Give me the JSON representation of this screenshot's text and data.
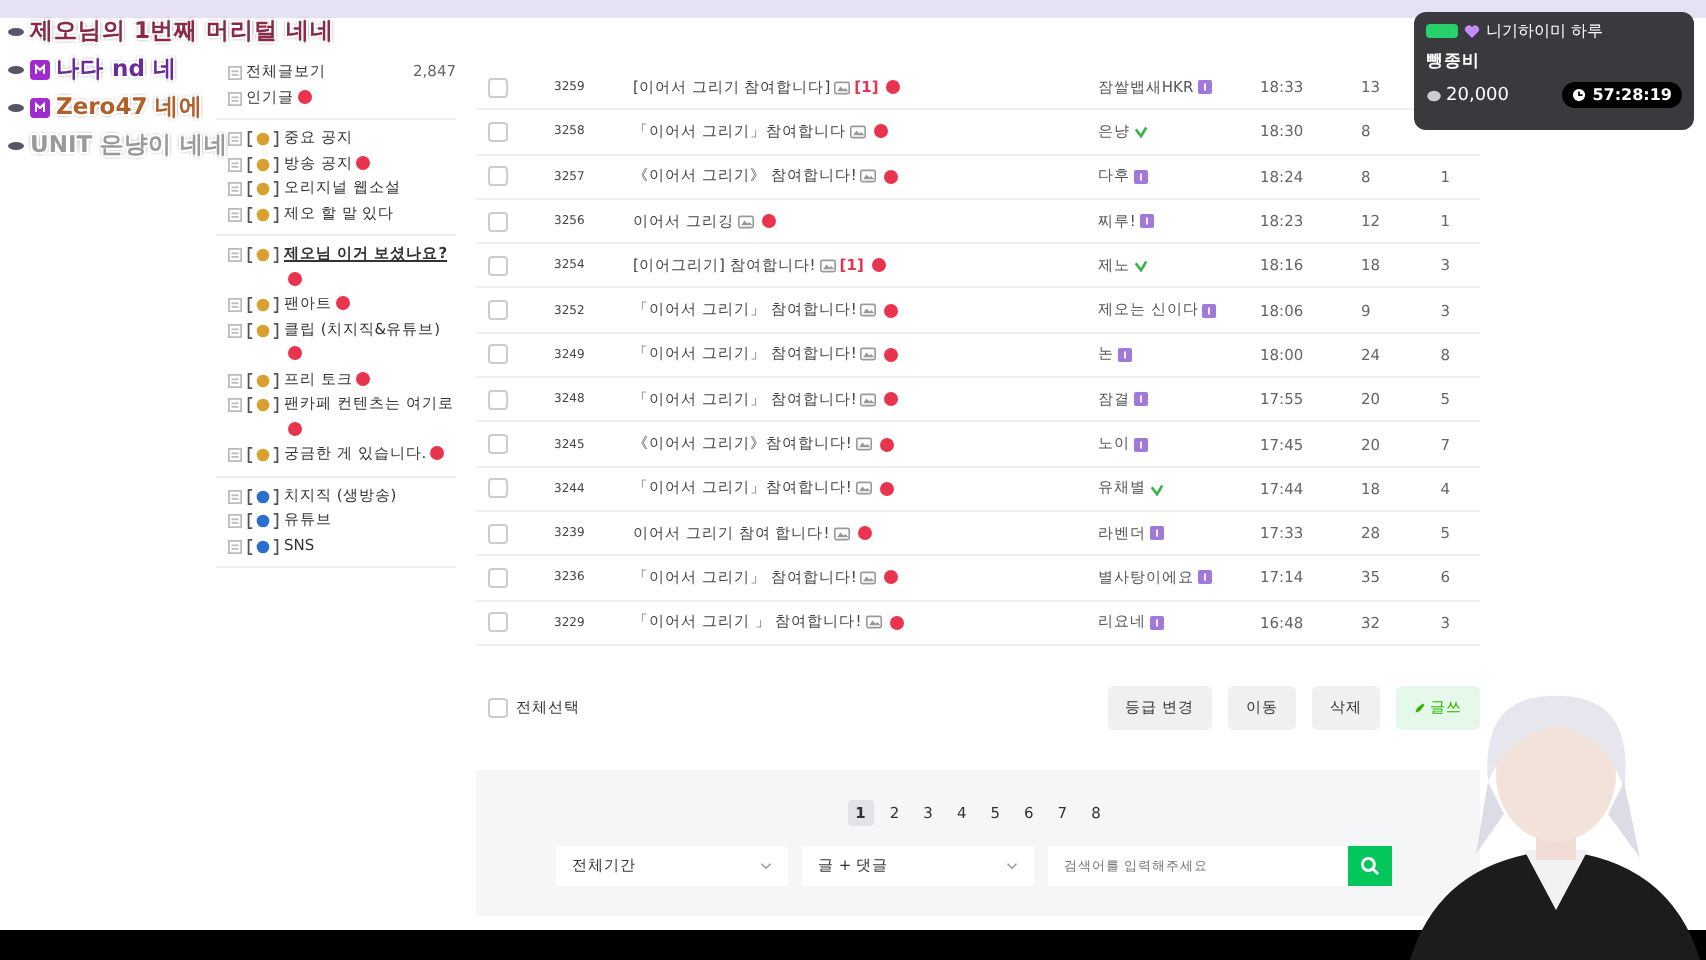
{
  "chat": [
    {
      "text": "제오님의 1번째 머리털 네네",
      "color": "#8a2a4a",
      "badge": false
    },
    {
      "text": "나다 nd 네",
      "color": "#6a2a9a",
      "badge": true
    },
    {
      "text": "Zero47 네에",
      "color": "#b0602a",
      "badge": true
    },
    {
      "text": "UNIT 은냥이 네네",
      "color": "#9a9a9a",
      "badge": false
    }
  ],
  "sidebar": {
    "groups": [
      [
        {
          "label": "전체글보기",
          "count": "2,847",
          "new": false,
          "bold": false
        },
        {
          "label": "인기글",
          "new": true,
          "bold": false
        }
      ],
      [
        {
          "label": "중요 공지",
          "new": false,
          "bold": false
        },
        {
          "label": "방송 공지",
          "new": true,
          "bold": false
        },
        {
          "label": "오리지널 웹소설",
          "new": false,
          "bold": false
        },
        {
          "label": "제오 할 말 있다",
          "new": false,
          "bold": false
        }
      ],
      [
        {
          "label": "제오님 이거 보셨나요?",
          "new": true,
          "bold": true
        },
        {
          "label": "팬아트",
          "new": true,
          "bold": false
        },
        {
          "label": "클립 (치지직&유튜브)",
          "new": true,
          "bold": false
        },
        {
          "label": "프리 토크",
          "new": true,
          "bold": false
        },
        {
          "label": "팬카페 컨텐츠는 여기로",
          "new": true,
          "bold": false
        },
        {
          "label": "궁금한 게 있습니다.",
          "new": true,
          "bold": false
        }
      ],
      [
        {
          "label": "치지직 (생방송)",
          "new": false,
          "bold": false
        },
        {
          "label": "유튜브",
          "new": false,
          "bold": false
        },
        {
          "label": "SNS",
          "new": false,
          "bold": false
        }
      ]
    ]
  },
  "rows": [
    {
      "checked": false,
      "no": "3259",
      "title": "[이어서 그리기 참여합니다]",
      "comments": "[1]",
      "author": "잠쌀뱁새HKR",
      "kind": "level",
      "time": "18:33",
      "views": "13"
    },
    {
      "checked": false,
      "no": "3258",
      "title": "「이어서 그리기」참여합니다",
      "author": "은냥",
      "kind": "check",
      "time": "18:30",
      "views": "8"
    },
    {
      "checked": false,
      "no": "3257",
      "title": "《이어서 그리기》 참여합니다!",
      "author": "다후",
      "kind": "level",
      "time": "18:24",
      "views": "8",
      "likes": "1"
    },
    {
      "checked": false,
      "no": "3256",
      "title": "이어서 그리깅",
      "author": "찌루!",
      "kind": "level",
      "time": "18:23",
      "views": "12",
      "likes": "1"
    },
    {
      "checked": false,
      "no": "3254",
      "title": "[이어그리기] 참여합니다!",
      "comments": "[1]",
      "author": "제노",
      "kind": "check",
      "time": "18:16",
      "views": "18",
      "likes": "3"
    },
    {
      "checked": false,
      "no": "3252",
      "title": "「이어서 그리기」 참여합니다!",
      "author": "제오는 신이다",
      "kind": "level",
      "time": "18:06",
      "views": "9",
      "likes": "3"
    },
    {
      "checked": false,
      "no": "3249",
      "title": "「이어서 그리기」 참여합니다!",
      "author": "논",
      "kind": "level",
      "time": "18:00",
      "views": "24",
      "likes": "8"
    },
    {
      "checked": false,
      "no": "3248",
      "title": "「이어서 그리기」 참여합니다!",
      "author": "잠결",
      "kind": "level",
      "time": "17:55",
      "views": "20",
      "likes": "5"
    },
    {
      "checked": false,
      "no": "3245",
      "title": "《이어서 그리기》참여합니다!",
      "author": "노이",
      "kind": "level",
      "time": "17:45",
      "views": "20",
      "likes": "7"
    },
    {
      "checked": false,
      "no": "3244",
      "title": "「이어서 그리기」참여합니다!",
      "author": "유채별",
      "kind": "check",
      "time": "17:44",
      "views": "18",
      "likes": "4"
    },
    {
      "checked": false,
      "no": "3239",
      "title": "이어서 그리기 참여 합니다!",
      "author": "라벤더",
      "kind": "level",
      "time": "17:33",
      "views": "28",
      "likes": "5"
    },
    {
      "checked": false,
      "no": "3236",
      "title": "「이어서 그리기」 참여합니다!",
      "author": "별사탕이에요",
      "kind": "level",
      "time": "17:14",
      "views": "35",
      "likes": "6"
    },
    {
      "checked": false,
      "no": "3229",
      "title": "「이어서 그리기 」 참여합니다!",
      "author": "리요네",
      "kind": "level",
      "time": "16:48",
      "views": "32",
      "likes": "3"
    }
  ],
  "select_all": {
    "label": "전체선택",
    "checked": false
  },
  "actions": [
    "등급 변경",
    "이동",
    "삭제"
  ],
  "write_button": "글쓰",
  "pages": [
    {
      "label": "1",
      "selected": true
    },
    {
      "label": "2",
      "selected": false
    },
    {
      "label": "3",
      "selected": false
    },
    {
      "label": "4",
      "selected": false
    },
    {
      "label": "5",
      "selected": false
    },
    {
      "label": "6",
      "selected": false
    },
    {
      "label": "7",
      "selected": false
    },
    {
      "label": "8",
      "selected": false
    }
  ],
  "search": {
    "period": "전체기간",
    "scope": "글 + 댓글",
    "placeholder": "검색어를 입력해주세요"
  },
  "donation": {
    "name": "니기하이미 하루",
    "title": "뺑종비",
    "amount": "20,000",
    "timer": "57:28:19"
  }
}
